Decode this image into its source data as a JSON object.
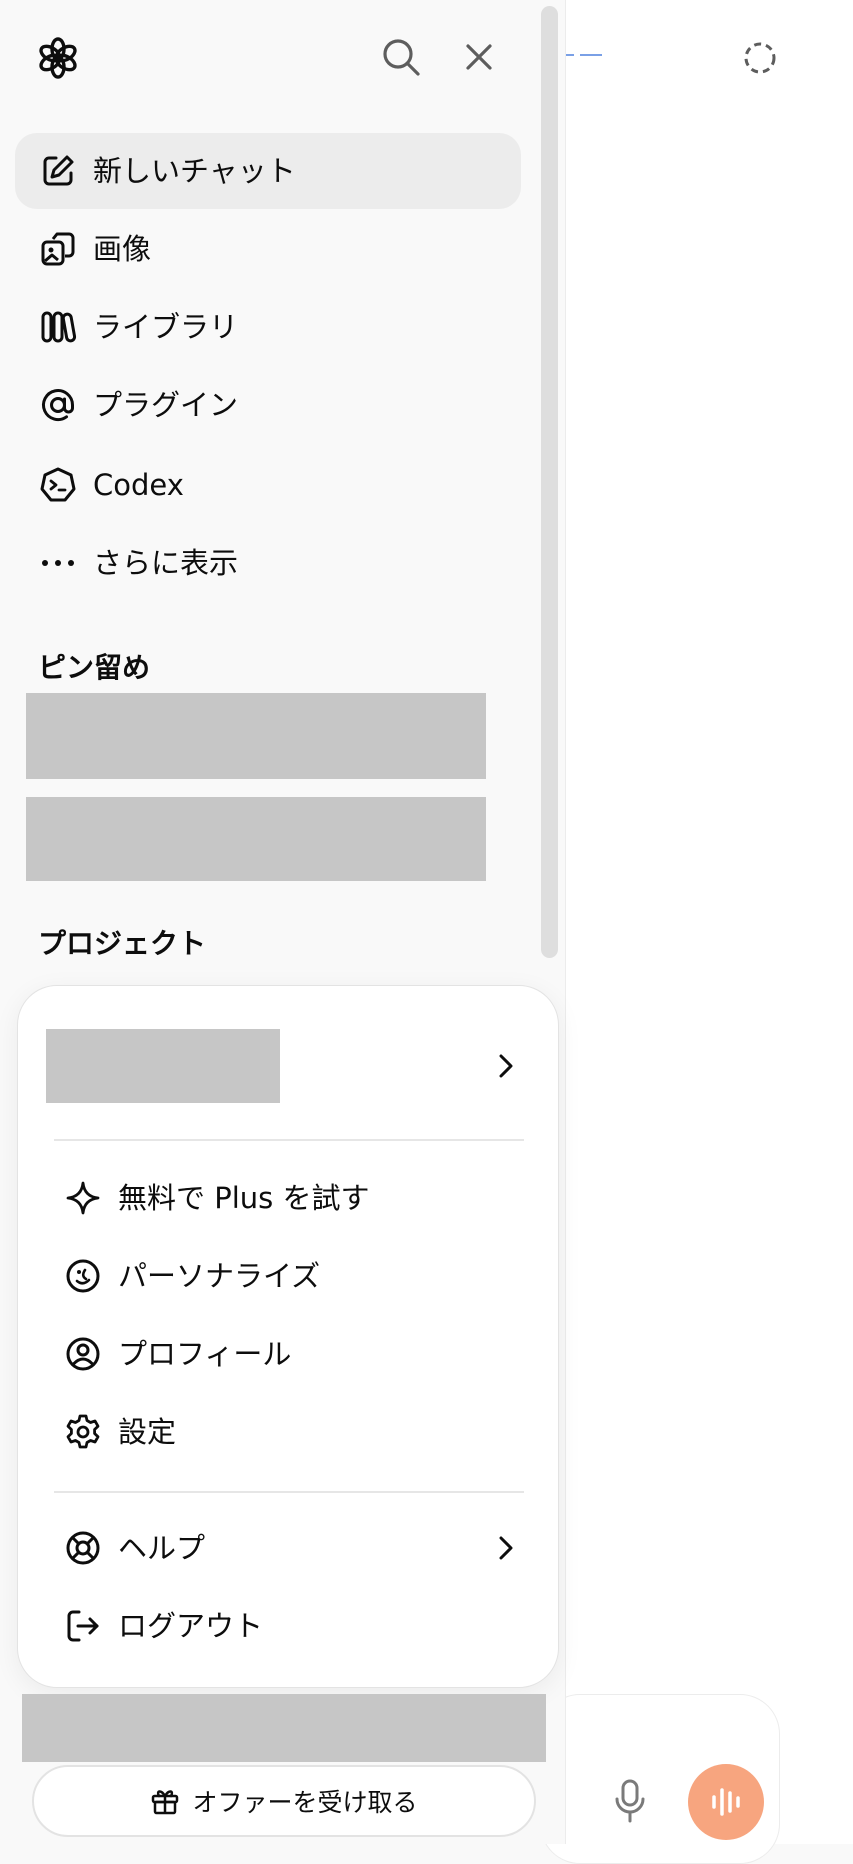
{
  "sidebar": {
    "nav": [
      {
        "label": "新しいチャット",
        "icon": "new-chat-icon",
        "active": true
      },
      {
        "label": "画像",
        "icon": "images-icon"
      },
      {
        "label": "ライブラリ",
        "icon": "library-icon"
      },
      {
        "label": "プラグイン",
        "icon": "at-sign-icon"
      },
      {
        "label": "Codex",
        "icon": "codex-icon"
      },
      {
        "label": "さらに表示",
        "icon": "more-dots-icon"
      }
    ],
    "pinned_title": "ピン留め",
    "projects_title": "プロジェクト"
  },
  "account_menu": {
    "items": [
      {
        "label": "無料で Plus を試す",
        "icon": "sparkle-icon"
      },
      {
        "label": "パーソナライズ",
        "icon": "personalize-icon"
      },
      {
        "label": "プロフィール",
        "icon": "profile-icon"
      },
      {
        "label": "設定",
        "icon": "gear-icon"
      }
    ],
    "help_label": "ヘルプ",
    "logout_label": "ログアウト"
  },
  "footer": {
    "offer_label": "オファーを受け取る"
  },
  "colors": {
    "sidebar_bg": "#f9f9f9",
    "active_item_bg": "#ececec",
    "redacted": "#c6c6c6",
    "voice_button": "#f7a57f",
    "link_accent": "#7aa0e6"
  }
}
